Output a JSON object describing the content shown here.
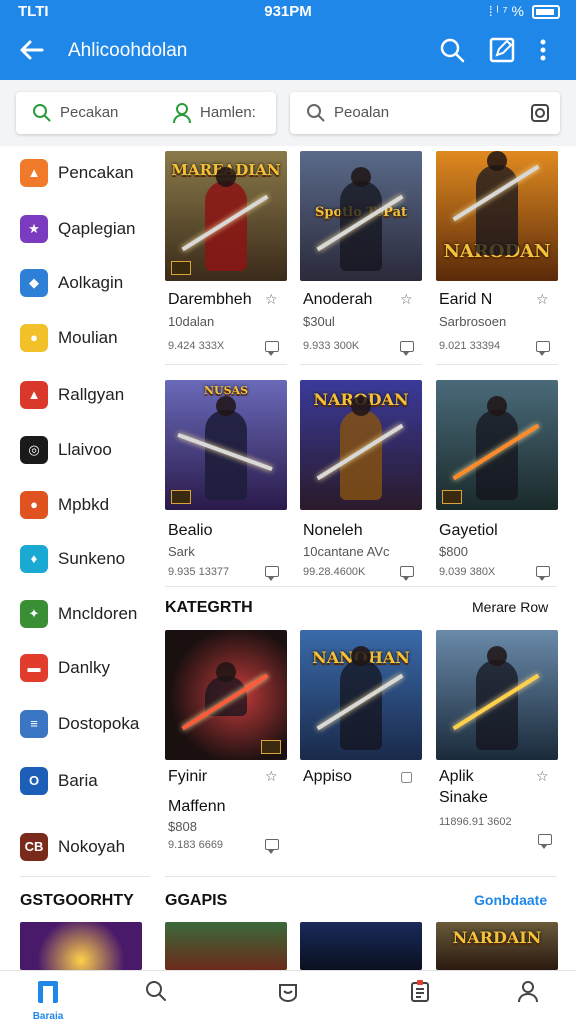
{
  "status": {
    "left": "TLTI",
    "time": "931PM",
    "right": "⁞ ˡ ⁷ %"
  },
  "header": {
    "title": "Ahlicoohdolan"
  },
  "search": {
    "left_label": "Pecakan",
    "middle_label": "Hamlen:",
    "right_label": "Peoalan"
  },
  "sidebar": {
    "items": [
      {
        "label": "Pencakan",
        "icon": "orange-app-icon",
        "color": "#f07a2a"
      },
      {
        "label": "Qaplegian",
        "icon": "purple-app-icon",
        "color": "#7a3bbf"
      },
      {
        "label": "Aolkagin",
        "icon": "blue-app-icon",
        "color": "#2e7fd6"
      },
      {
        "label": "Moulian",
        "icon": "yellow-app-icon",
        "color": "#f2c12a"
      },
      {
        "label": "Rallgyan",
        "icon": "red-mountain-app-icon",
        "color": "#d9382a"
      },
      {
        "label": "Llaivoo",
        "icon": "black-app-icon",
        "color": "#1a1a1a"
      },
      {
        "label": "Mpbkd",
        "icon": "red-orange-app-icon",
        "color": "#e0521f"
      },
      {
        "label": "Sunkeno",
        "icon": "cyan-app-icon",
        "color": "#1aa9d3"
      },
      {
        "label": "Mncldoren",
        "icon": "green-app-icon",
        "color": "#3a8f35"
      },
      {
        "label": "Danlky",
        "icon": "ticket-app-icon",
        "color": "#e23c2c"
      },
      {
        "label": "Dostopoka",
        "icon": "chart-app-icon",
        "color": "#3b76c4"
      },
      {
        "label": "Baria",
        "icon": "navy-app-icon",
        "color": "#1d5fb8"
      },
      {
        "label": "Nokoyah",
        "icon": "brown-app-icon",
        "color": "#7a2a1a"
      }
    ]
  },
  "grid": {
    "row1": [
      {
        "name": "Darembheh",
        "sub": "10dalan",
        "num": "9.424 333X",
        "banner": "MAREADIAN",
        "bg": "#5a4a2a"
      },
      {
        "name": "Anoderah",
        "sub": "$30ul",
        "num": "9.933 300K",
        "banner": "Spotlo ToPat",
        "bg": "#3a4a6a"
      },
      {
        "name": "Earid N",
        "sub": "Sarbrosoen",
        "num": "9.021 33394",
        "banner": "NARODAN",
        "bg": "#8a4a10"
      }
    ],
    "row2": [
      {
        "name": "Bealio",
        "sub": "Sark",
        "num": "9.935 13377",
        "banner": "NUSAS",
        "bg": "#3a3a8a"
      },
      {
        "name": "Noneleh",
        "sub": "10cantane AVc",
        "num": "99.28.4600K",
        "banner": "NARODAN",
        "bg": "#2a2a5a"
      },
      {
        "name": "Gayetiol",
        "sub": "$800",
        "num": "9.039 380X",
        "banner": "",
        "bg": "#2a4a5a"
      }
    ],
    "row3": [
      {
        "name": "Fyinir",
        "sub": "Maffenn",
        "sub2": "$808",
        "num": "9.183 6669",
        "banner": "",
        "bg": "#2a1a1a"
      },
      {
        "name": "Appiso",
        "sub": "",
        "sub2": "",
        "num": "",
        "banner": "NANOHAN",
        "bg": "#1a3a6a"
      },
      {
        "name": "Aplik",
        "sub": "Sinake",
        "sub2": "",
        "num": "11896.91 3602",
        "banner": "",
        "bg": "#3a5a7a"
      }
    ],
    "row4": [
      {
        "banner": "",
        "bg": "#3a1a4a"
      },
      {
        "banner": "",
        "bg": "#5a2a1a"
      },
      {
        "banner": "",
        "bg": "#1a2a4a"
      },
      {
        "banner": "NARDAIN",
        "bg": "#4a3a2a"
      }
    ]
  },
  "sections": {
    "kategrth": "KATEGRTH",
    "more": "Merare Row",
    "left_category": "GSTGOORHTY",
    "gapis": "GGAPIS",
    "gonb": "Gonbdaate"
  },
  "bottom": {
    "home_label": "Baraia"
  },
  "colors": {
    "accent": "#1f87e8"
  }
}
